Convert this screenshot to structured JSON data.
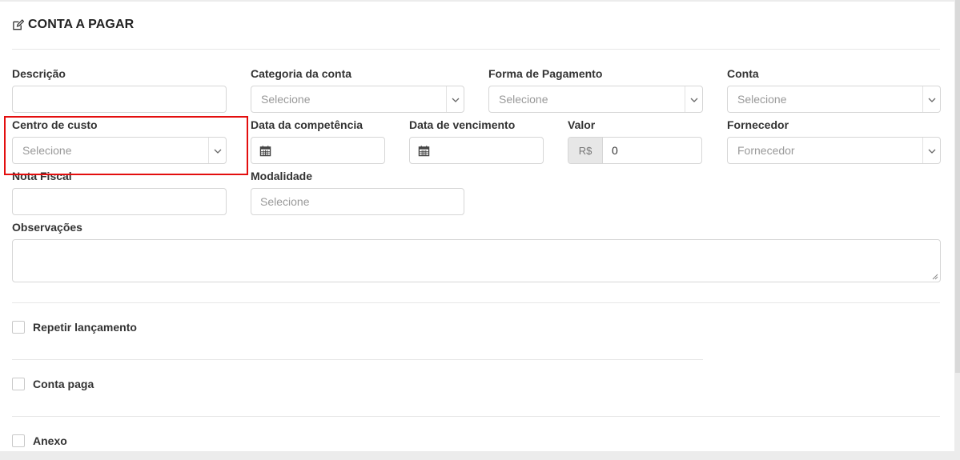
{
  "header": {
    "title": "CONTA A PAGAR",
    "icon": "edit-icon"
  },
  "fields": {
    "descricao": {
      "label": "Descrição",
      "value": ""
    },
    "categoria": {
      "label": "Categoria da conta",
      "placeholder": "Selecione"
    },
    "forma_pagamento": {
      "label": "Forma de Pagamento",
      "placeholder": "Selecione"
    },
    "conta": {
      "label": "Conta",
      "placeholder": "Selecione"
    },
    "centro_custo": {
      "label": "Centro de custo",
      "placeholder": "Selecione"
    },
    "data_competencia": {
      "label": "Data da competência",
      "value": ""
    },
    "data_vencimento": {
      "label": "Data de vencimento",
      "value": ""
    },
    "valor": {
      "label": "Valor",
      "prefix": "R$",
      "value": "0"
    },
    "fornecedor": {
      "label": "Fornecedor",
      "placeholder": "Fornecedor"
    },
    "nota_fiscal": {
      "label": "Nota Fiscal",
      "value": ""
    },
    "modalidade": {
      "label": "Modalidade",
      "placeholder": "Selecione"
    },
    "observacoes": {
      "label": "Observações",
      "value": ""
    }
  },
  "checkboxes": {
    "repetir": {
      "label": "Repetir lançamento",
      "checked": false
    },
    "conta_paga": {
      "label": "Conta paga",
      "checked": false
    },
    "anexo": {
      "label": "Anexo",
      "checked": false
    }
  },
  "colors": {
    "highlight": "#e30e0e",
    "border": "#d6d6d6",
    "prefix_bg": "#e7e7e7"
  }
}
